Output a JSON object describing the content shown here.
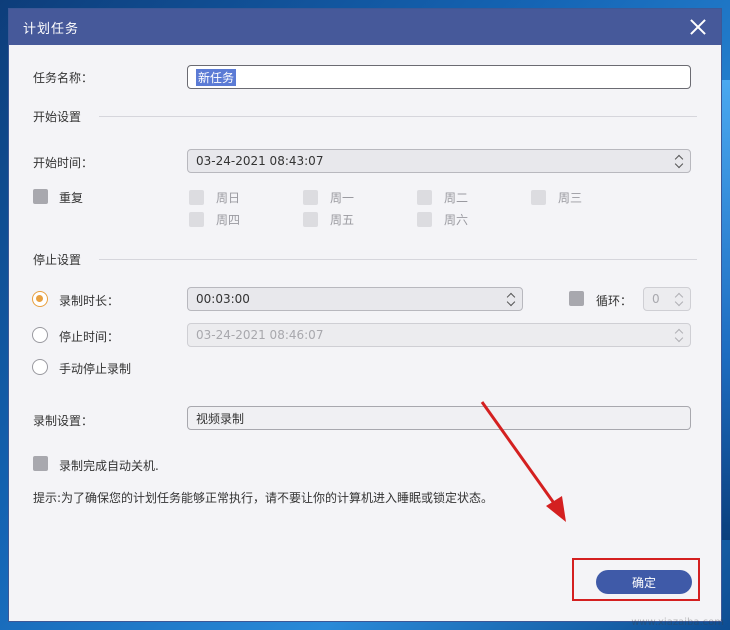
{
  "dialog": {
    "title": "计划任务",
    "task_name_label": "任务名称：",
    "task_name_value": "新任务",
    "start_section_title": "开始设置",
    "start_time_label": "开始时间：",
    "start_time_value": "03-24-2021  08:43:07",
    "repeat_label": "重复",
    "days": [
      "周日",
      "周一",
      "周二",
      "周三",
      "周四",
      "周五",
      "周六"
    ],
    "stop_section_title": "停止设置",
    "record_duration_label": "录制时长：",
    "record_duration_value": "00:03:00",
    "loop_label": "循环：",
    "loop_value": "0",
    "stop_time_label": "停止时间：",
    "stop_time_value": "03-24-2021  08:46:07",
    "manual_stop_label": "手动停止录制",
    "record_settings_label": "录制设置：",
    "record_settings_value": "视频录制",
    "auto_shutdown_label": "录制完成自动关机.",
    "tip_text": "提示:为了确保您的计划任务能够正常执行，请不要让你的计算机进入睡眠或锁定状态。",
    "ok_button": "确定"
  },
  "colors": {
    "titlebar": "#46599a",
    "accent_radio": "#e8a040",
    "ok_button": "#3f5aa8",
    "annotation_red": "#d42020"
  },
  "watermark": "www.xiazaiba.com"
}
